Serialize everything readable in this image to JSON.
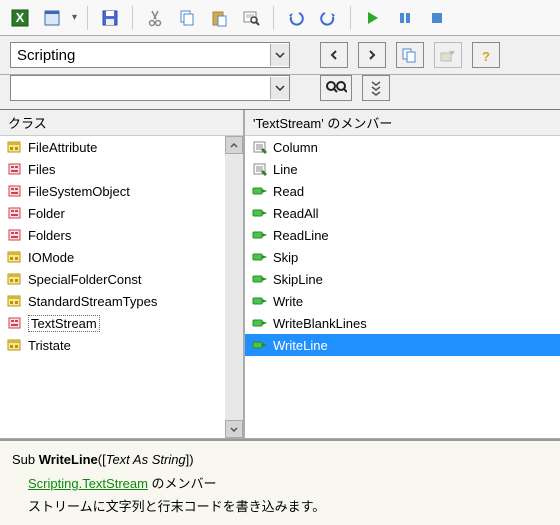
{
  "toolbar": {
    "excel": "X",
    "form": "□",
    "save": "💾",
    "cut": "✂",
    "copy": "📄",
    "paste": "📋",
    "find": "🔍",
    "undo": "↶",
    "redo": "↷",
    "run": "▶",
    "pause": "❚❚",
    "stop": "■"
  },
  "library_dropdown": {
    "value": "Scripting"
  },
  "search_dropdown": {
    "value": ""
  },
  "panels": {
    "classes_header": "クラス",
    "members_header": "'TextStream' のメンバー"
  },
  "classes": [
    {
      "icon": "enum",
      "label": "FileAttribute"
    },
    {
      "icon": "class",
      "label": "Files"
    },
    {
      "icon": "class",
      "label": "FileSystemObject"
    },
    {
      "icon": "class",
      "label": "Folder"
    },
    {
      "icon": "class",
      "label": "Folders"
    },
    {
      "icon": "enum",
      "label": "IOMode"
    },
    {
      "icon": "enum",
      "label": "SpecialFolderConst"
    },
    {
      "icon": "enum",
      "label": "StandardStreamTypes"
    },
    {
      "icon": "class",
      "label": "TextStream",
      "selected": true
    },
    {
      "icon": "enum",
      "label": "Tristate"
    }
  ],
  "members": [
    {
      "icon": "prop",
      "label": "Column"
    },
    {
      "icon": "prop",
      "label": "Line"
    },
    {
      "icon": "method",
      "label": "Read"
    },
    {
      "icon": "method",
      "label": "ReadAll"
    },
    {
      "icon": "method",
      "label": "ReadLine"
    },
    {
      "icon": "method",
      "label": "Skip"
    },
    {
      "icon": "method",
      "label": "SkipLine"
    },
    {
      "icon": "method",
      "label": "Write"
    },
    {
      "icon": "method",
      "label": "WriteBlankLines"
    },
    {
      "icon": "method",
      "label": "WriteLine",
      "highlighted": true
    }
  ],
  "detail": {
    "sub_kw": "Sub ",
    "name": "WriteLine",
    "open": "([",
    "param": "Text As String",
    "close": "])",
    "link": "Scripting.TextStream",
    "link_suffix": " のメンバー",
    "desc": "ストリームに文字列と行末コードを書き込みます。"
  }
}
